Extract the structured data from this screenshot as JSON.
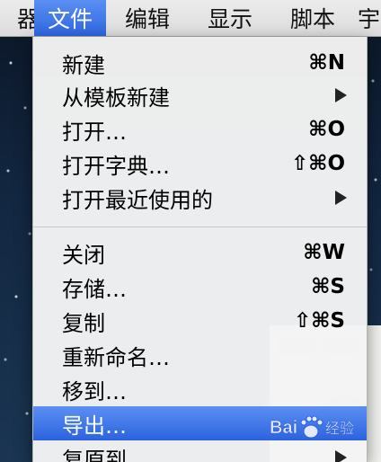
{
  "menubar": {
    "items": [
      {
        "label": "器"
      },
      {
        "label": "文件"
      },
      {
        "label": "编辑"
      },
      {
        "label": "显示"
      },
      {
        "label": "脚本"
      },
      {
        "label": "宇"
      }
    ]
  },
  "file_menu": {
    "items": [
      {
        "label": "新建",
        "shortcut": "⌘N"
      },
      {
        "label": "从模板新建",
        "submenu": true
      },
      {
        "label": "打开…",
        "shortcut": "⌘O"
      },
      {
        "label": "打开字典…",
        "shortcut": "⇧⌘O"
      },
      {
        "label": "打开最近使用的",
        "submenu": true
      },
      {
        "label": "关闭",
        "shortcut": "⌘W"
      },
      {
        "label": "存储…",
        "shortcut": "⌘S"
      },
      {
        "label": "复制",
        "shortcut": "⇧⌘S"
      },
      {
        "label": "重新命名…"
      },
      {
        "label": "移到…"
      },
      {
        "label": "导出…",
        "highlighted": true
      },
      {
        "label": "复原到",
        "submenu": true
      }
    ]
  },
  "watermark": {
    "brand": "Bai",
    "brand_suffix": "经验",
    "icon": "paw-icon"
  },
  "colors": {
    "highlight": "#2f67e0",
    "menubar": "#e4e4e4",
    "menu_bg": "#f4f4f4"
  }
}
